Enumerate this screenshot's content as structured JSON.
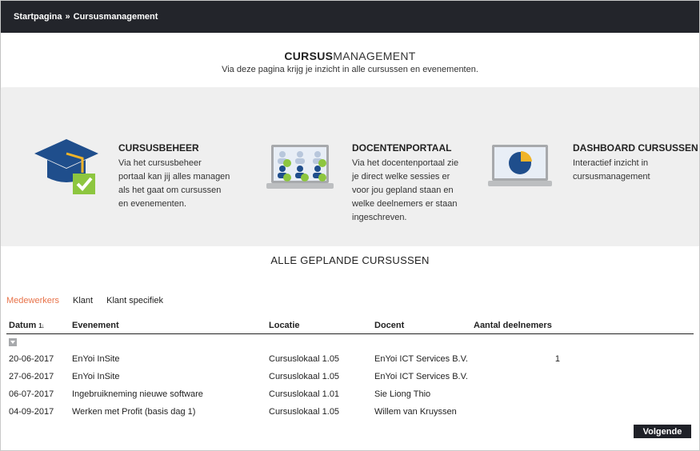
{
  "breadcrumb": {
    "home": "Startpagina",
    "separator": "»",
    "current": "Cursusmanagement"
  },
  "header": {
    "title_bold": "CURSUS",
    "title_light": "MANAGEMENT",
    "subtitle": "Via deze pagina krijg je inzicht in alle cursussen en evenementen."
  },
  "tiles": [
    {
      "title": "CURSUSBEHEER",
      "text": "Via het cursusbeheer portaal kan jij alles managen als het gaat om cursussen en evenementen.",
      "icon": "graduation-cap-check-icon"
    },
    {
      "title": "DOCENTENPORTAAL",
      "text": "Via het docentenportaal zie je direct welke sessies er voor jou gepland staan en welke deelnemers er staan ingeschreven.",
      "icon": "laptop-users-icon"
    },
    {
      "title": "DASHBOARD CURSUSSEN",
      "text": "Interactief inzicht in cursusmanagement",
      "icon": "laptop-pie-chart-icon"
    }
  ],
  "section_title": "ALLE GEPLANDE CURSUSSEN",
  "tabs": [
    "Medewerkers",
    "Klant",
    "Klant specifiek"
  ],
  "active_tab": "Medewerkers",
  "table": {
    "columns": [
      "Datum",
      "Evenement",
      "Locatie",
      "Docent",
      "Aantal deelnemers"
    ],
    "rows": [
      [
        "20-06-2017",
        "EnYoi InSite",
        "Cursuslokaal 1.05",
        "EnYoi ICT Services B.V.",
        "1"
      ],
      [
        "27-06-2017",
        "EnYoi InSite",
        "Cursuslokaal 1.05",
        "EnYoi ICT Services B.V.",
        ""
      ],
      [
        "06-07-2017",
        "Ingebruikneming nieuwe software",
        "Cursuslokaal 1.01",
        "Sie Liong Thio",
        ""
      ],
      [
        "04-09-2017",
        "Werken met Profit (basis dag 1)",
        "Cursuslokaal 1.05",
        "Willem van Kruyssen",
        ""
      ]
    ]
  },
  "next_button": "Volgende",
  "colors": {
    "topbar": "#23252b",
    "accent": "#e8734a",
    "band": "#efefef",
    "navy": "#1f4e8c",
    "green": "#8dc63f",
    "gold": "#f0b429"
  }
}
